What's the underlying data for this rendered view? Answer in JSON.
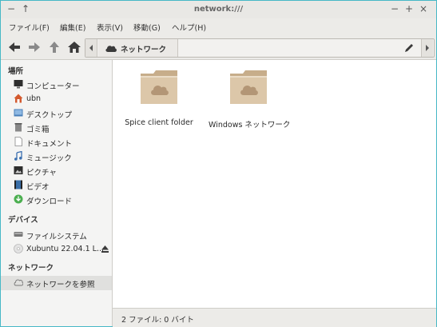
{
  "window": {
    "title": "network:///"
  },
  "menubar": {
    "items": [
      "ファイル(F)",
      "編集(E)",
      "表示(V)",
      "移動(G)",
      "ヘルプ(H)"
    ]
  },
  "pathbar": {
    "current": "ネットワーク"
  },
  "sidebar": {
    "sections": [
      {
        "title": "場所",
        "items": [
          {
            "label": "コンピューター",
            "icon": "monitor-icon"
          },
          {
            "label": "ubn",
            "icon": "home-icon"
          },
          {
            "label": "デスクトップ",
            "icon": "desktop-icon"
          },
          {
            "label": "ゴミ箱",
            "icon": "trash-icon"
          },
          {
            "label": "ドキュメント",
            "icon": "document-icon"
          },
          {
            "label": "ミュージック",
            "icon": "music-icon"
          },
          {
            "label": "ピクチャ",
            "icon": "pictures-icon"
          },
          {
            "label": "ビデオ",
            "icon": "video-icon"
          },
          {
            "label": "ダウンロード",
            "icon": "download-icon"
          }
        ]
      },
      {
        "title": "デバイス",
        "items": [
          {
            "label": "ファイルシステム",
            "icon": "drive-icon"
          },
          {
            "label": "Xubuntu 22.04.1 L...",
            "icon": "disc-icon"
          }
        ]
      },
      {
        "title": "ネットワーク",
        "items": [
          {
            "label": "ネットワークを参照",
            "icon": "network-icon"
          }
        ]
      }
    ]
  },
  "files": [
    {
      "name": "Spice client folder",
      "icon": "network-folder-icon"
    },
    {
      "name": "Windows ネットワーク",
      "icon": "network-folder-icon"
    }
  ],
  "status": {
    "text": "2 ファイル: 0 バイト"
  },
  "colors": {
    "accent": "#46b8c6",
    "folder": "#d9c3a5",
    "folder_dark": "#c7ad8a",
    "cloud": "#b09070"
  }
}
